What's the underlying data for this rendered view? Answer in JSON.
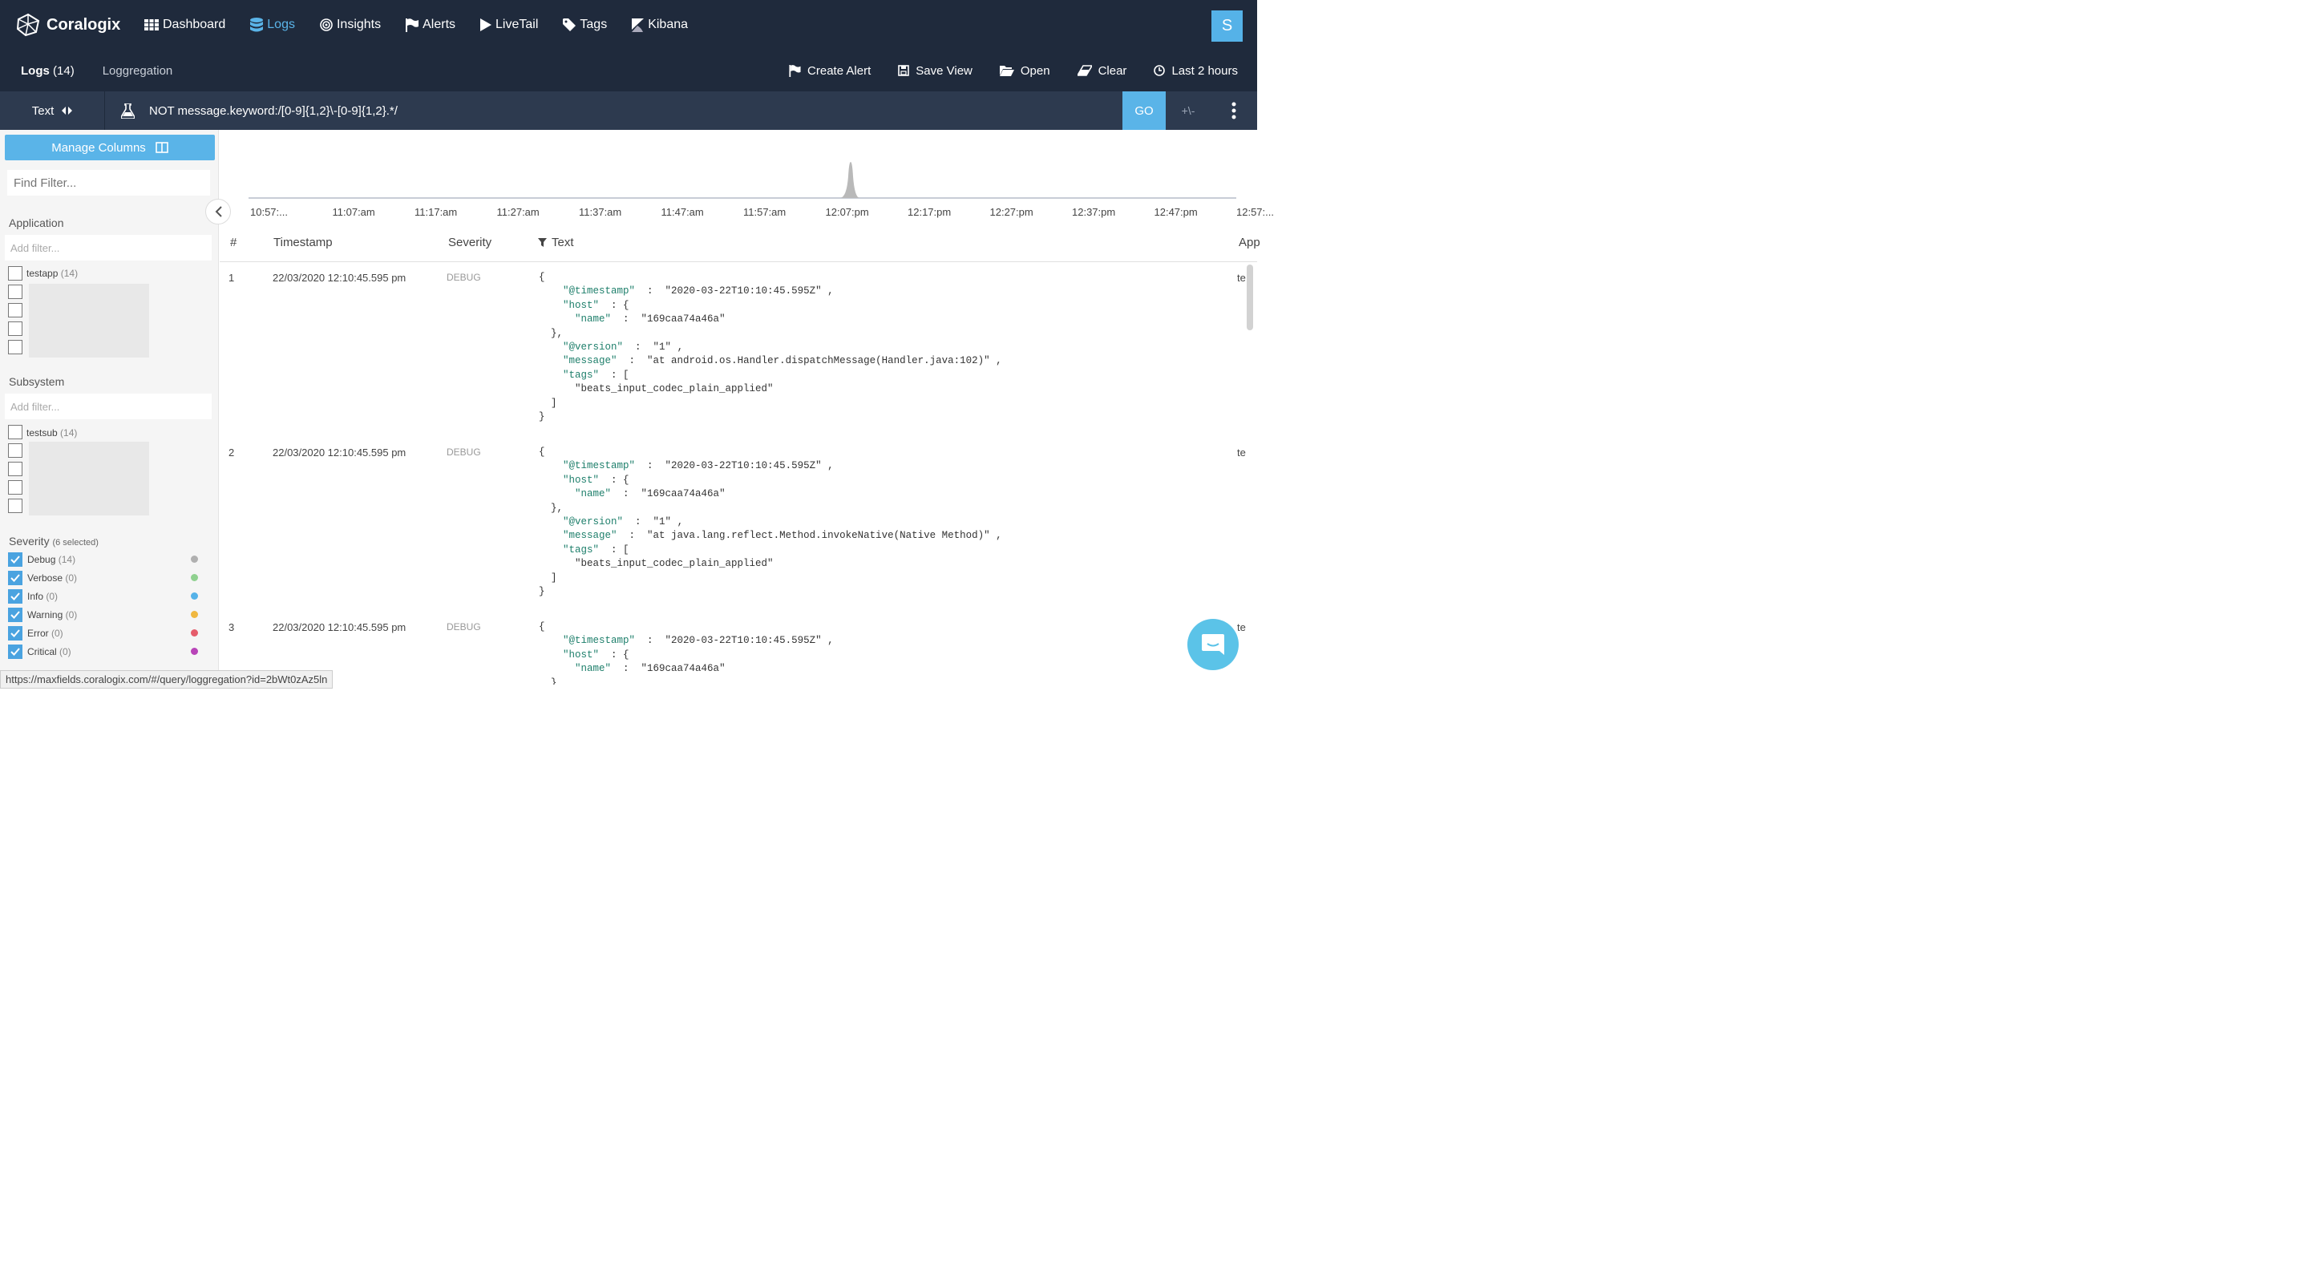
{
  "brand": {
    "name": "Coralogix"
  },
  "nav": [
    {
      "label": "Dashboard",
      "icon": "grid-icon",
      "active": false
    },
    {
      "label": "Logs",
      "icon": "database-icon",
      "active": true
    },
    {
      "label": "Insights",
      "icon": "target-icon",
      "active": false
    },
    {
      "label": "Alerts",
      "icon": "flag-icon",
      "active": false
    },
    {
      "label": "LiveTail",
      "icon": "play-icon",
      "active": false
    },
    {
      "label": "Tags",
      "icon": "tag-icon",
      "active": false
    },
    {
      "label": "Kibana",
      "icon": "kibana-icon",
      "active": false
    }
  ],
  "user": {
    "initial": "S"
  },
  "tabs": {
    "logs": "Logs",
    "logs_count": "(14)",
    "loggregation": "Loggregation"
  },
  "actions": {
    "create_alert": "Create Alert",
    "save_view": "Save View",
    "open": "Open",
    "clear": "Clear",
    "time_range": "Last 2 hours"
  },
  "query": {
    "mode": "Text",
    "value": "NOT message.keyword:/[0-9]{1,2}\\-[0-9]{1,2}.*/",
    "go": "GO",
    "plus_minus": "+\\-"
  },
  "sidebar": {
    "manage_columns": "Manage Columns",
    "find_filter_placeholder": "Find Filter...",
    "application": {
      "title": "Application",
      "add_filter": "Add filter...",
      "items": [
        {
          "label": "testapp",
          "count": "(14)"
        }
      ]
    },
    "subsystem": {
      "title": "Subsystem",
      "add_filter": "Add filter...",
      "items": [
        {
          "label": "testsub",
          "count": "(14)"
        }
      ]
    },
    "severity": {
      "title": "Severity",
      "selected": "(6 selected)",
      "items": [
        {
          "label": "Debug",
          "count": "(14)",
          "color": "#b0b0b0"
        },
        {
          "label": "Verbose",
          "count": "(0)",
          "color": "#8fd18f"
        },
        {
          "label": "Info",
          "count": "(0)",
          "color": "#55b2e8"
        },
        {
          "label": "Warning",
          "count": "(0)",
          "color": "#f0b840"
        },
        {
          "label": "Error",
          "count": "(0)",
          "color": "#e55c6b"
        },
        {
          "label": "Critical",
          "count": "(0)",
          "color": "#b844b8"
        }
      ]
    }
  },
  "histogram": {
    "ticks": [
      "10:57:...",
      "11:07:am",
      "11:17:am",
      "11:27:am",
      "11:37:am",
      "11:47:am",
      "11:57:am",
      "12:07:pm",
      "12:17:pm",
      "12:27:pm",
      "12:37:pm",
      "12:47:pm",
      "12:57:..."
    ]
  },
  "table": {
    "headers": {
      "num": "#",
      "timestamp": "Timestamp",
      "severity": "Severity",
      "text": "Text",
      "app": "App"
    },
    "rows": [
      {
        "num": "1",
        "timestamp": "22/03/2020 12:10:45.595 pm",
        "severity": "DEBUG",
        "app": "te",
        "ts_value": "\"2020-03-22T10:10:45.595Z\"",
        "host_name": "\"169caa74a46a\"",
        "version": "\"1\"",
        "message": "\"at android.os.Handler.dispatchMessage(Handler.java:102)\"",
        "tag": "\"beats_input_codec_plain_applied\""
      },
      {
        "num": "2",
        "timestamp": "22/03/2020 12:10:45.595 pm",
        "severity": "DEBUG",
        "app": "te",
        "ts_value": "\"2020-03-22T10:10:45.595Z\"",
        "host_name": "\"169caa74a46a\"",
        "version": "\"1\"",
        "message": "\"at java.lang.reflect.Method.invokeNative(Native Method)\"",
        "tag": "\"beats_input_codec_plain_applied\""
      },
      {
        "num": "3",
        "timestamp": "22/03/2020 12:10:45.595 pm",
        "severity": "DEBUG",
        "app": "te",
        "ts_value": "\"2020-03-22T10:10:45.595Z\"",
        "host_name": "\"169caa74a46a\""
      }
    ],
    "keys": {
      "timestamp": "\"@timestamp\"",
      "host": "\"host\"",
      "name": "\"name\"",
      "version": "\"@version\"",
      "message": "\"message\"",
      "tags": "\"tags\""
    }
  },
  "status_url": "https://maxfields.coralogix.com/#/query/loggregation?id=2bWt0zAz5ln"
}
